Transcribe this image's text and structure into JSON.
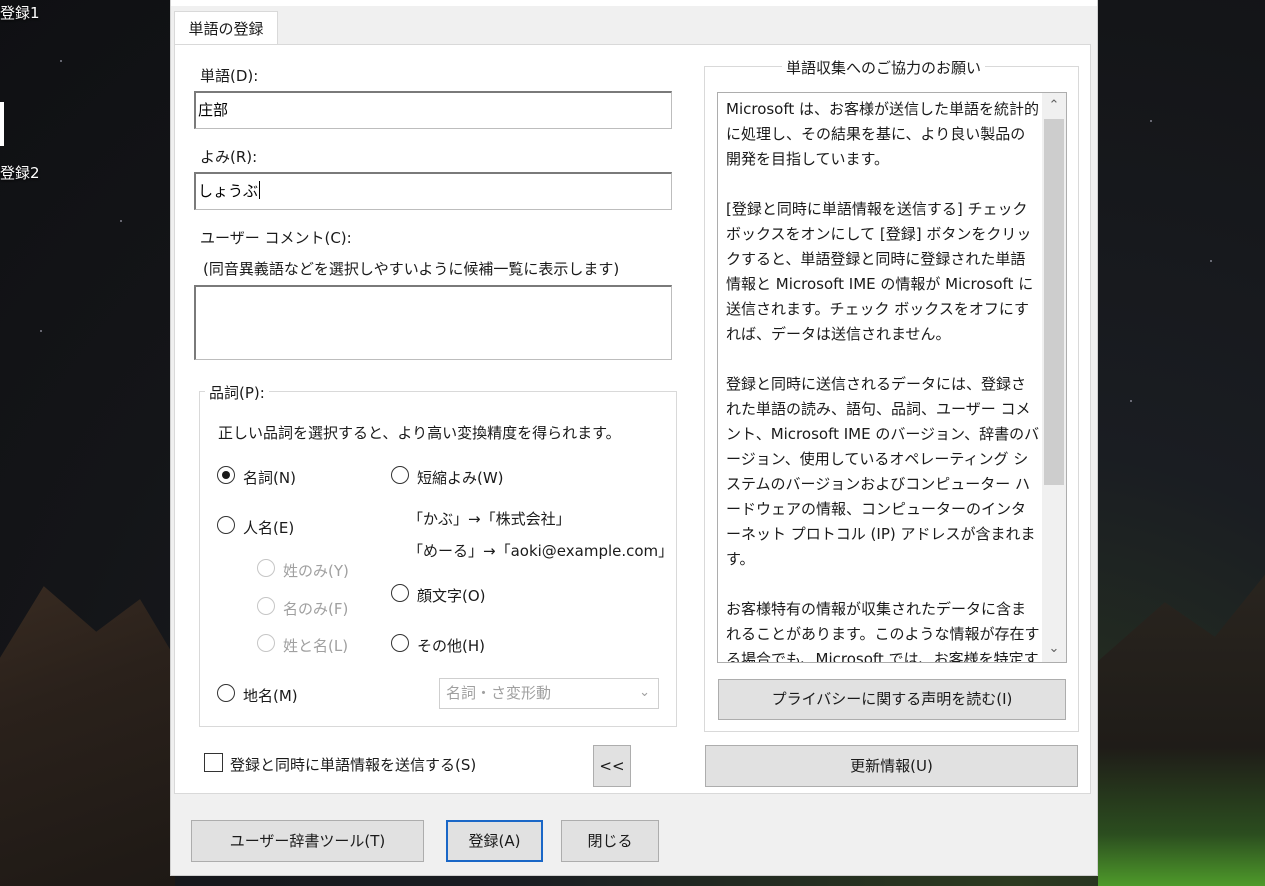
{
  "desktop": {
    "icon1_label": "登録1",
    "icon2_label": "登録2"
  },
  "dialog": {
    "tab_label": "単語の登録",
    "word": {
      "label": "単語(D):",
      "value": "庄部"
    },
    "reading": {
      "label": "よみ(R):",
      "value": "しょうぶ"
    },
    "comment": {
      "label": "ユーザー コメント(C):",
      "hint": "(同音異義語などを選択しやすいように候補一覧に表示します)",
      "value": ""
    },
    "pos_group": {
      "title": "品詞(P):",
      "description": "正しい品詞を選択すると、より高い変換精度を得られます。",
      "noun": "名詞(N)",
      "person": "人名(E)",
      "surname_only": "姓のみ(Y)",
      "givenname_only": "名のみ(F)",
      "surname_and_name": "姓と名(L)",
      "place": "地名(M)",
      "abbrev": "短縮よみ(W)",
      "abbrev_example1": "「かぶ」→「株式会社」",
      "abbrev_example2": "「めーる」→「aoki@example.com」",
      "emoticon": "顔文字(O)",
      "other": "その他(H)",
      "sub_select_value": "名詞・さ変形動",
      "selected": "noun"
    },
    "send_checkbox": {
      "label": "登録と同時に単語情報を送信する(S)",
      "checked": false
    },
    "collapse_button": "<<",
    "info_group": {
      "title": "単語収集へのご協力のお願い",
      "paragraphs": [
        "Microsoft は、お客様が送信した単語を統計的に処理し、その結果を基に、より良い製品の開発を目指しています。",
        "[登録と同時に単語情報を送信する] チェック ボックスをオンにして [登録] ボタンをクリックすると、単語登録と同時に登録された単語情報と Microsoft IME の情報が Microsoft に送信されます。チェック ボックスをオフにすれば、データは送信されません。",
        "登録と同時に送信されるデータには、登録された単語の読み、語句、品詞、ユーザー コメント、Microsoft IME のバージョン、辞書のバージョン、使用しているオペレーティング システムのバージョンおよびコンピューター ハードウェアの情報、コンピューターのインターネット プロトコル (IP) アドレスが含まれます。",
        "お客様特有の情報が収集されたデータに含まれることがあります。このような情報が存在する場合でも、Microsoft では、お客様を特定するために使用することはありません。"
      ],
      "privacy_button": "プライバシーに関する声明を読む(I)"
    },
    "update_button": "更新情報(U)",
    "user_dict_button": "ユーザー辞書ツール(T)",
    "register_button": "登録(A)",
    "close_button": "閉じる"
  },
  "colors": {
    "dialog_bg": "#f0f0f0",
    "panel_bg": "#ffffff",
    "button_bg": "#e1e1e1",
    "primary_border": "#1a67c7",
    "disabled_text": "#a0a0a0"
  }
}
